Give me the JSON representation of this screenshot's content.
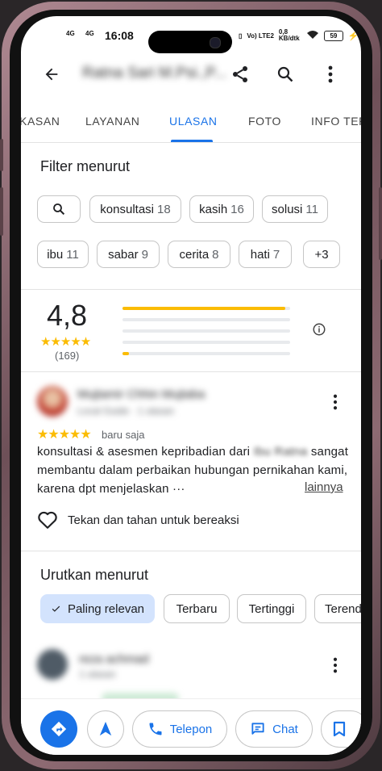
{
  "status": {
    "time": "16:08",
    "net1": "4G",
    "net2": "4G",
    "volte": "Vo) LTE2",
    "speed": "0,8 KB/dtk",
    "battery": "59"
  },
  "header": {
    "title": "Ratna Sari M.Psi.,P..."
  },
  "tabs": [
    {
      "label": "KASAN"
    },
    {
      "label": "LAYANAN"
    },
    {
      "label": "ULASAN",
      "active": true
    },
    {
      "label": "FOTO"
    },
    {
      "label": "INFO TER"
    }
  ],
  "filter": {
    "title": "Filter menurut",
    "chips": [
      {
        "label": "konsultasi",
        "count": "18"
      },
      {
        "label": "kasih",
        "count": "16"
      },
      {
        "label": "solusi",
        "count": "11"
      },
      {
        "label": "ibu",
        "count": "11"
      },
      {
        "label": "sabar",
        "count": "9"
      },
      {
        "label": "cerita",
        "count": "8"
      },
      {
        "label": "hati",
        "count": "7"
      }
    ],
    "more_label": "+3"
  },
  "rating": {
    "value": "4,8",
    "stars": "★★★★★",
    "count": "(169)",
    "distribution": [
      0.97,
      0.0,
      0.0,
      0.0,
      0.04
    ]
  },
  "review1": {
    "author": "Mujtamir Chhin Mujtaba",
    "subtitle": "Local Guide · 1 ulasan",
    "stars": "★★★★★",
    "time": "baru saja",
    "text_start": "konsultasi & asesmen kepribadian dari",
    "text_blur": "Ibu Ratna",
    "text_rest": "sangat membantu dalam perbaikan hubungan pernikahan kami, karena dpt menjelaskan ···",
    "more_label": "lainnya",
    "react_label": "Tekan dan tahan untuk bereaksi"
  },
  "sort": {
    "title": "Urutkan menurut",
    "options": [
      {
        "label": "Paling relevan",
        "selected": true
      },
      {
        "label": "Terbaru"
      },
      {
        "label": "Tertinggi"
      },
      {
        "label": "Terend"
      }
    ]
  },
  "review2": {
    "author": "reza achmad",
    "subtitle": "1 ulasan"
  },
  "bottom": {
    "call_label": "Telepon",
    "chat_label": "Chat"
  },
  "colors": {
    "accent": "#1a73e8",
    "star": "#fbbc04",
    "selected_chip": "#d3e3fd"
  }
}
